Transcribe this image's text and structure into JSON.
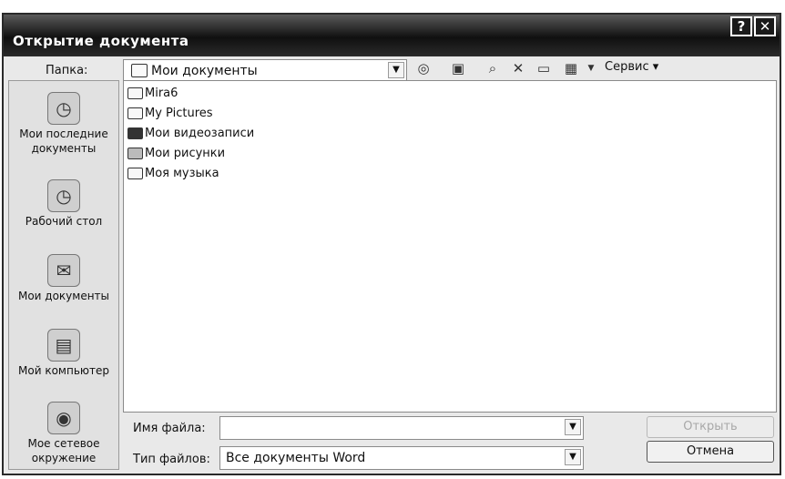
{
  "window": {
    "title": "Открытие документа",
    "help_glyph": "?",
    "close_glyph": "✕"
  },
  "folder": {
    "label": "Папка:",
    "value": "Мои документы"
  },
  "toolbar": {
    "service_label": "Сервис ▾"
  },
  "places": [
    {
      "label": "Мои последние документы",
      "icon": "recent-documents-icon"
    },
    {
      "label": "Рабочий стол",
      "icon": "desktop-icon"
    },
    {
      "label": "Мои документы",
      "icon": "my-documents-icon"
    },
    {
      "label": "Мой компьютер",
      "icon": "my-computer-icon"
    },
    {
      "label": "Мое сетевое окружение",
      "icon": "network-places-icon"
    }
  ],
  "files": [
    {
      "name": "Mira6",
      "icon": "folder-icon"
    },
    {
      "name": "My Pictures",
      "icon": "folder-icon"
    },
    {
      "name": "Мои видеозаписи",
      "icon": "video-folder-icon"
    },
    {
      "name": "Мои рисунки",
      "icon": "pictures-folder-icon"
    },
    {
      "name": "Моя музыка",
      "icon": "folder-icon"
    }
  ],
  "filename": {
    "label": "Имя файла:",
    "value": ""
  },
  "filetype": {
    "label": "Тип файлов:",
    "value": "Все документы Word"
  },
  "buttons": {
    "open": "Открыть",
    "cancel": "Отмена"
  }
}
